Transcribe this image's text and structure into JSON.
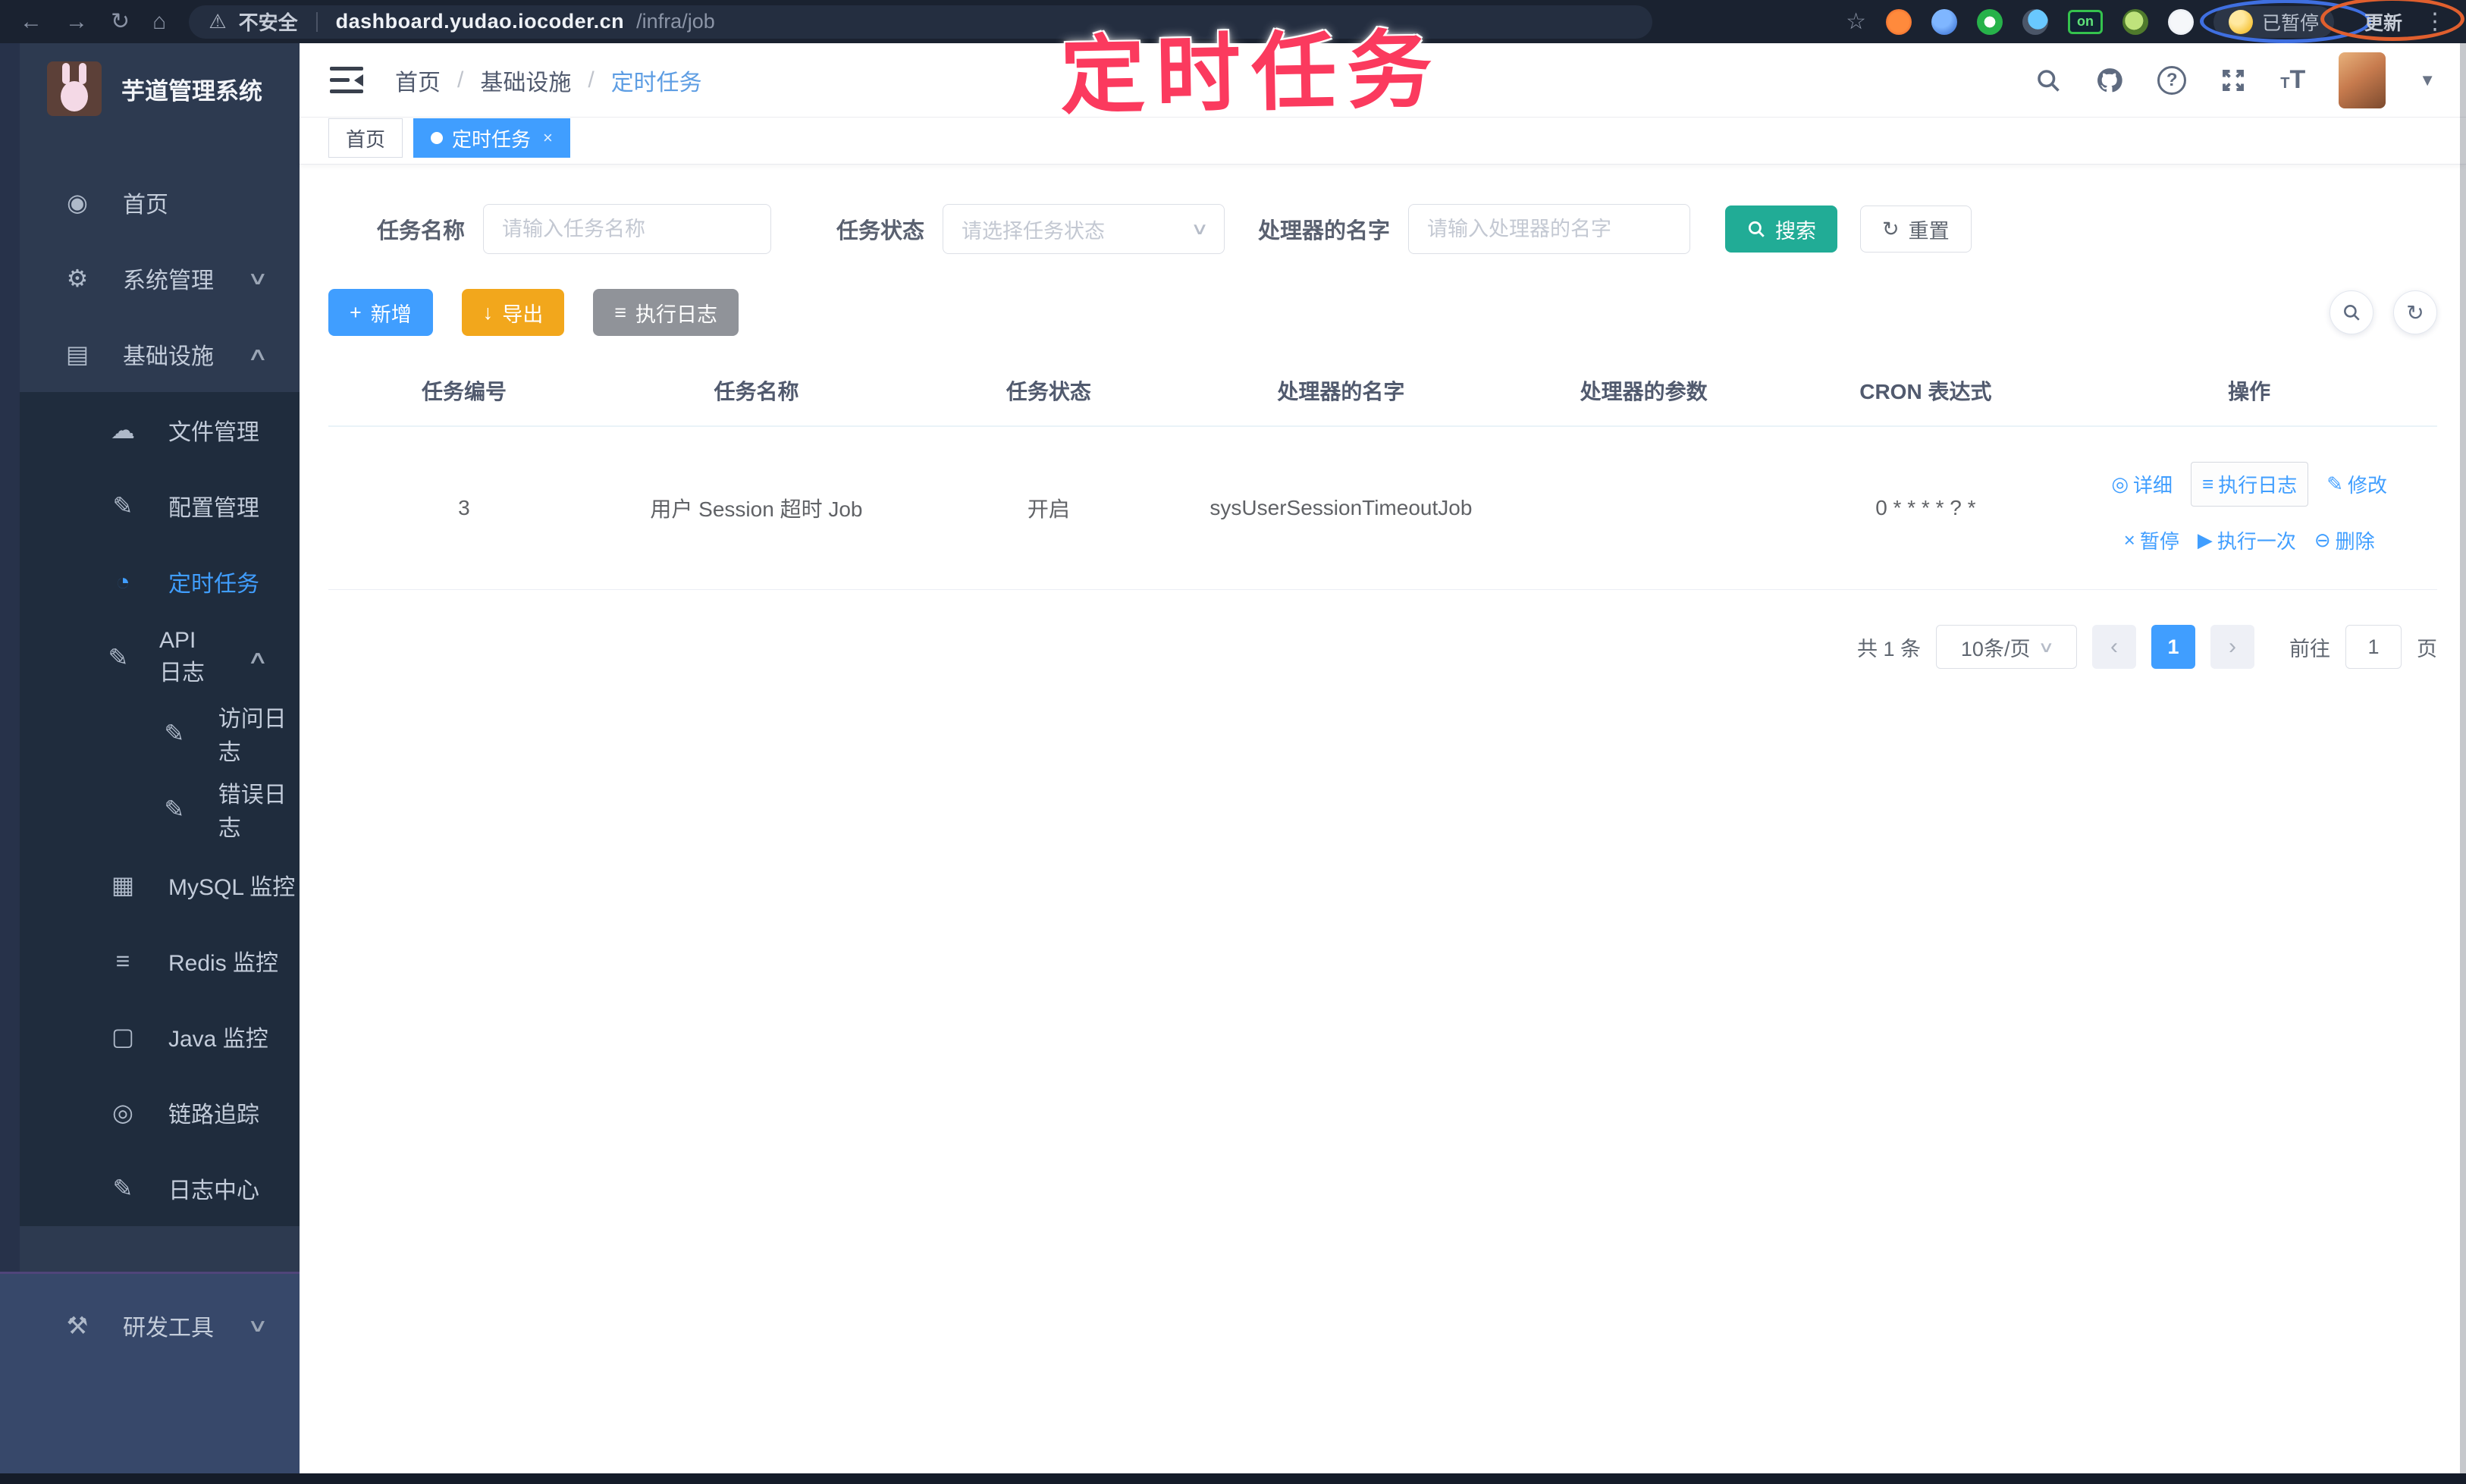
{
  "colors": {
    "accent_blue": "#409eff",
    "search_teal": "#21ac96",
    "export_orange": "#f2a71c",
    "info_gray": "#909399",
    "sidebar_bg": "#2d3a50",
    "submenu_bg": "#1f2c3d",
    "chrome_bg": "#1a2230",
    "annotation_pink": "#fb3a5e"
  },
  "annotation": {
    "title": "定时任务"
  },
  "browser": {
    "security_label": "不安全",
    "url_host": "dashboard.yudao.iocoder.cn",
    "url_path": "/infra/job",
    "extension_badge": "on",
    "profile_status": "已暂停",
    "update_label": "更新"
  },
  "sidebar": {
    "app_title": "芋道管理系统",
    "items": [
      {
        "label": "首页"
      },
      {
        "label": "系统管理"
      },
      {
        "label": "基础设施"
      },
      {
        "label": "文件管理"
      },
      {
        "label": "配置管理"
      },
      {
        "label": "定时任务"
      },
      {
        "label": "API 日志"
      },
      {
        "label": "访问日志"
      },
      {
        "label": "错误日志"
      },
      {
        "label": "MySQL 监控"
      },
      {
        "label": "Redis 监控"
      },
      {
        "label": "Java 监控"
      },
      {
        "label": "链路追踪"
      },
      {
        "label": "日志中心"
      },
      {
        "label": "研发工具"
      }
    ]
  },
  "header": {
    "breadcrumb": [
      "首页",
      "基础设施",
      "定时任务"
    ],
    "separator": "/"
  },
  "tabs": [
    {
      "label": "首页"
    },
    {
      "label": "定时任务"
    }
  ],
  "filters": {
    "job_name": {
      "label": "任务名称",
      "placeholder": "请输入任务名称"
    },
    "job_status": {
      "label": "任务状态",
      "placeholder": "请选择任务状态"
    },
    "handler_name": {
      "label": "处理器的名字",
      "placeholder": "请输入处理器的名字"
    },
    "search_label": "搜索",
    "reset_label": "重置"
  },
  "toolbar": {
    "add_label": "新增",
    "export_label": "导出",
    "log_label": "执行日志"
  },
  "table": {
    "columns": [
      "任务编号",
      "任务名称",
      "任务状态",
      "处理器的名字",
      "处理器的参数",
      "CRON 表达式",
      "操作"
    ],
    "rows": [
      {
        "id": "3",
        "name": "用户 Session 超时 Job",
        "status": "开启",
        "handler": "sysUserSessionTimeoutJob",
        "param": "",
        "cron": "0 * * * * ? *",
        "actions": [
          "详细",
          "执行日志",
          "修改",
          "暂停",
          "执行一次",
          "删除"
        ]
      }
    ]
  },
  "pagination": {
    "total": "共 1 条",
    "page_size": "10条/页",
    "current_page": "1",
    "goto_label": "前往",
    "goto_value": "1",
    "page_unit": "页"
  }
}
